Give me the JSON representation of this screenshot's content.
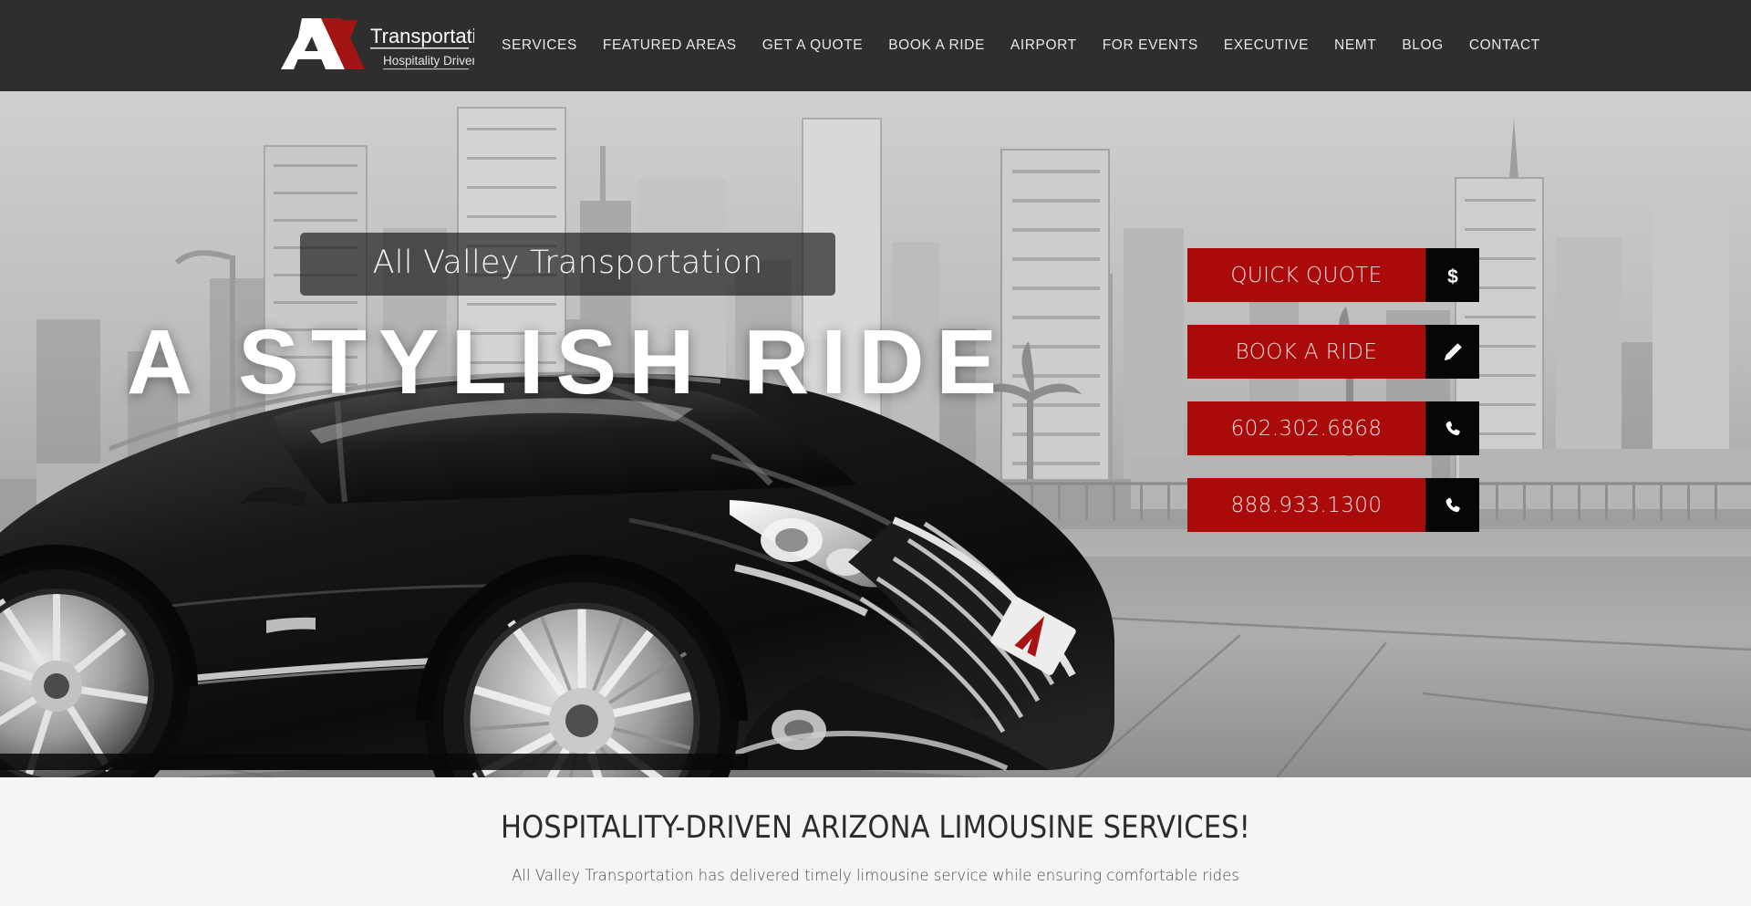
{
  "site": {
    "logo": {
      "monogram": "AV",
      "name": "Transportation",
      "tagline": "Hospitality Driven"
    },
    "colors": {
      "header_bg": "#2e2e2e",
      "accent_red": "#aa0a0a",
      "logo_red": "#a31515",
      "icon_box": "#060606",
      "lower_bg": "#f6f5f3"
    }
  },
  "nav": {
    "items": [
      {
        "label": "SERVICES"
      },
      {
        "label": "FEATURED AREAS"
      },
      {
        "label": "GET A QUOTE"
      },
      {
        "label": "BOOK A RIDE"
      },
      {
        "label": "AIRPORT"
      },
      {
        "label": "FOR EVENTS"
      },
      {
        "label": "EXECUTIVE"
      },
      {
        "label": "NEMT"
      },
      {
        "label": "BLOG"
      },
      {
        "label": "CONTACT"
      }
    ]
  },
  "hero": {
    "subtitle": "All Valley Transportation",
    "headline": "A STYLISH RIDE",
    "cta": [
      {
        "label": "QUICK QUOTE",
        "icon": "dollar-icon"
      },
      {
        "label": "BOOK A RIDE",
        "icon": "pencil-icon"
      },
      {
        "label": "602.302.6868",
        "icon": "phone-icon"
      },
      {
        "label": "888.933.1300",
        "icon": "phone-icon"
      }
    ]
  },
  "intro": {
    "title": "HOSPITALITY-DRIVEN ARIZONA LIMOUSINE SERVICES!",
    "body": "All Valley Transportation has delivered timely limousine service while ensuring comfortable rides"
  }
}
